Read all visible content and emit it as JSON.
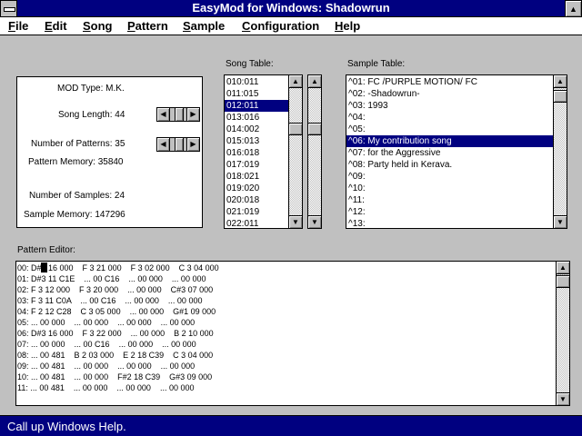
{
  "window": {
    "title": "EasyMod for Windows: Shadowrun"
  },
  "menu": [
    "File",
    "Edit",
    "Song",
    "Pattern",
    "Sample",
    "Configuration",
    "Help"
  ],
  "info": {
    "mod_type": "MOD Type: M.K.",
    "song_length": "Song Length: 44",
    "num_patterns": "Number of Patterns: 35",
    "pattern_memory": "Pattern Memory: 35840",
    "num_samples": "Number of Samples: 24",
    "sample_memory": "Sample Memory: 147296"
  },
  "song_table": {
    "label": "Song Table:",
    "rows": [
      "010:011",
      "011:015",
      "012:011",
      "013:016",
      "014:002",
      "015:013",
      "016:018",
      "017:019",
      "018:021",
      "019:020",
      "020:018",
      "021:019",
      "022:011"
    ],
    "selected_index": 2
  },
  "sample_table": {
    "label": "Sample Table:",
    "rows": [
      "^01: FC /PURPLE MOTION/ FC",
      "^02:       -Shadowrun-",
      "^03:           1993",
      "^04:",
      "^05:",
      "^06: My contribution song",
      "^07: for the Aggressive",
      "^08: Party held in Kerava.",
      "^09:",
      "^10:",
      "^11:",
      "^12:",
      "^13:"
    ],
    "selected_index": 5
  },
  "pattern_editor": {
    "label": "Pattern Editor:",
    "rows": [
      "00: D#3 16 000    F 3 21 000    F 3 02 000    C 3 04 000",
      "01: D#3 11 C1E    ... 00 C16    ... 00 000    ... 00 000",
      "02: F 3 12 000    F 3 20 000    ... 00 000    C#3 07 000",
      "03: F 3 11 C0A    ... 00 C16    ... 00 000    ... 00 000",
      "04: F 2 12 C28    C 3 05 000    ... 00 000    G#1 09 000",
      "05: ... 00 000    ... 00 000    ... 00 000    ... 00 000",
      "06: D#3 16 000    F 3 22 000    ... 00 000    B 2 10 000",
      "07: ... 00 000    ... 00 C16    ... 00 000    ... 00 000",
      "08: ... 00 481    B 2 03 000    E 2 18 C39    C 3 04 000",
      "09: ... 00 481    ... 00 000    ... 00 000    ... 00 000",
      "10: ... 00 481    ... 00 000    F#2 18 C39    G#3 09 000",
      "11: ... 00 481    ... 00 000    ... 00 000    ... 00 000"
    ]
  },
  "status": "Call up Windows Help.",
  "colors": {
    "titlebar": "#000080",
    "selection": "#000080",
    "face": "#c0c0c0"
  }
}
